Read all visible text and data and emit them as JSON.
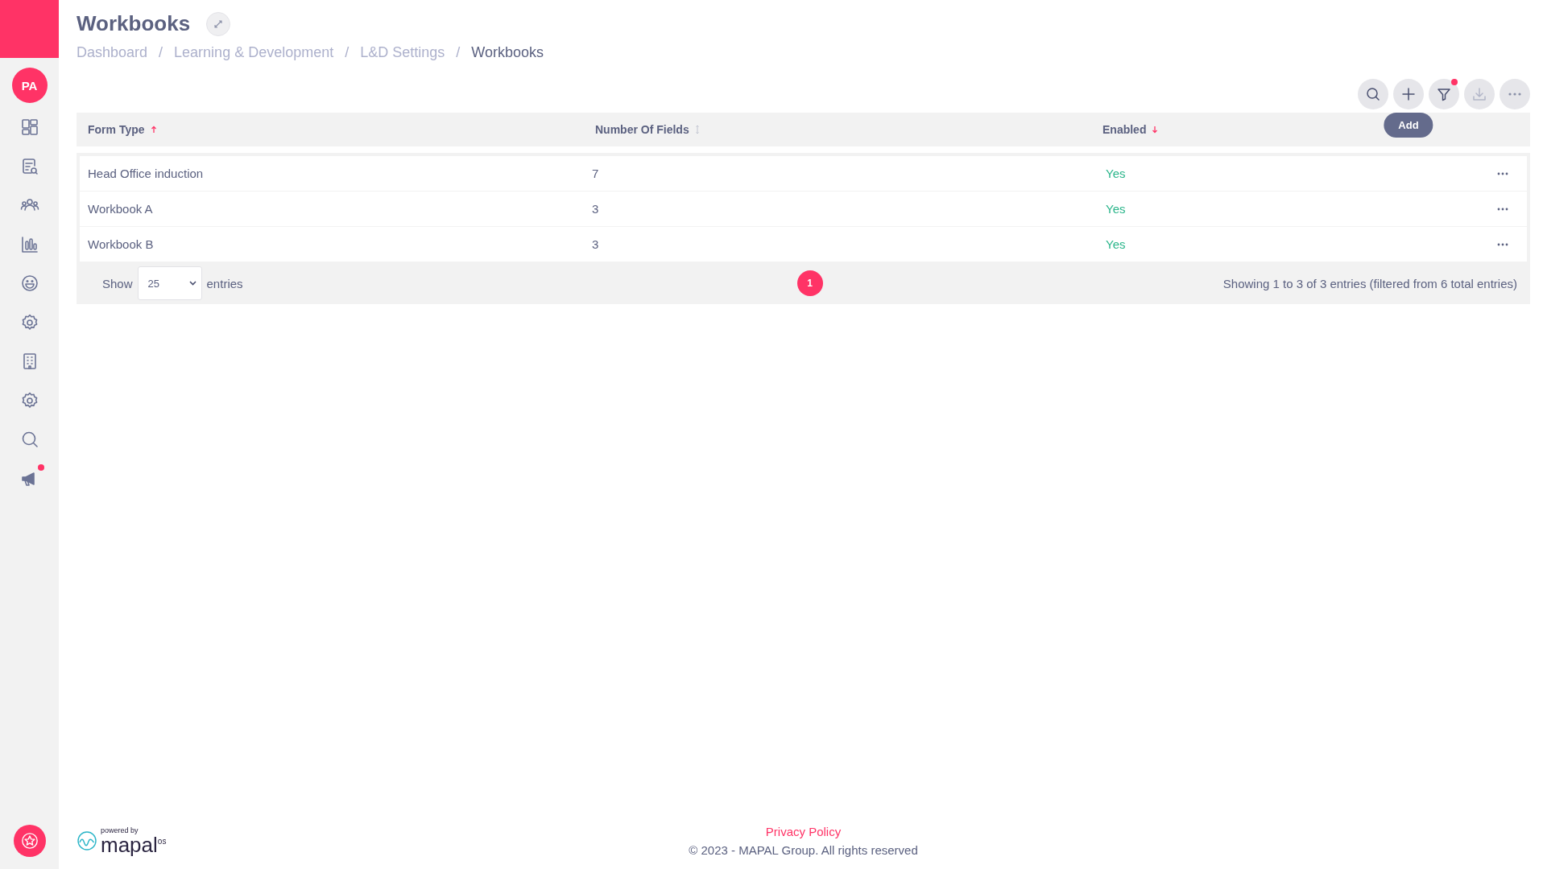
{
  "sidebar": {
    "avatar": "PA",
    "items": [
      {
        "kind": "dashboard",
        "badge": false
      },
      {
        "kind": "form-search",
        "badge": false
      },
      {
        "kind": "people",
        "badge": false
      },
      {
        "kind": "chart",
        "badge": false
      },
      {
        "kind": "smiley",
        "badge": false
      },
      {
        "kind": "gear",
        "badge": false
      },
      {
        "kind": "building",
        "badge": false
      },
      {
        "kind": "gear",
        "badge": false
      },
      {
        "kind": "search",
        "badge": false
      },
      {
        "kind": "megaphone",
        "badge": true
      }
    ]
  },
  "header": {
    "title": "Workbooks",
    "breadcrumb": [
      {
        "label": "Dashboard",
        "current": false
      },
      {
        "label": "Learning & Development",
        "current": false
      },
      {
        "label": "L&D Settings",
        "current": false
      },
      {
        "label": "Workbooks",
        "current": true
      }
    ],
    "separator": "/"
  },
  "toolbar": {
    "buttons": [
      {
        "kind": "search",
        "badge": false,
        "disabled": false
      },
      {
        "kind": "add",
        "badge": false,
        "disabled": false,
        "tooltip": "Add"
      },
      {
        "kind": "filter",
        "badge": true,
        "disabled": false
      },
      {
        "kind": "download",
        "badge": false,
        "disabled": true
      },
      {
        "kind": "more",
        "badge": false,
        "disabled": false
      }
    ]
  },
  "table": {
    "columns": [
      {
        "label": "Form Type",
        "sorted": true,
        "descending": false
      },
      {
        "label": "Number Of Fields",
        "sorted": false
      },
      {
        "label": "Enabled",
        "sorted": true,
        "descending": true
      }
    ],
    "rows": [
      {
        "form_type": "Head Office induction",
        "fields": "7",
        "enabled": "Yes"
      },
      {
        "form_type": "Workbook A",
        "fields": "3",
        "enabled": "Yes"
      },
      {
        "form_type": "Workbook B",
        "fields": "3",
        "enabled": "Yes"
      }
    ],
    "show_label": "Show",
    "page_size": "25",
    "entries_label": "entries",
    "pages": [
      {
        "label": "1",
        "selected": true
      }
    ],
    "summary": "Showing 1 to 3 of 3 entries (filtered from 6 total entries)"
  },
  "footer": {
    "powered_by": "powered by",
    "brand": "mapal",
    "brand_suffix": "os",
    "privacy": "Privacy Policy",
    "copyright": "© 2023 - MAPAL Group. All rights reserved"
  }
}
